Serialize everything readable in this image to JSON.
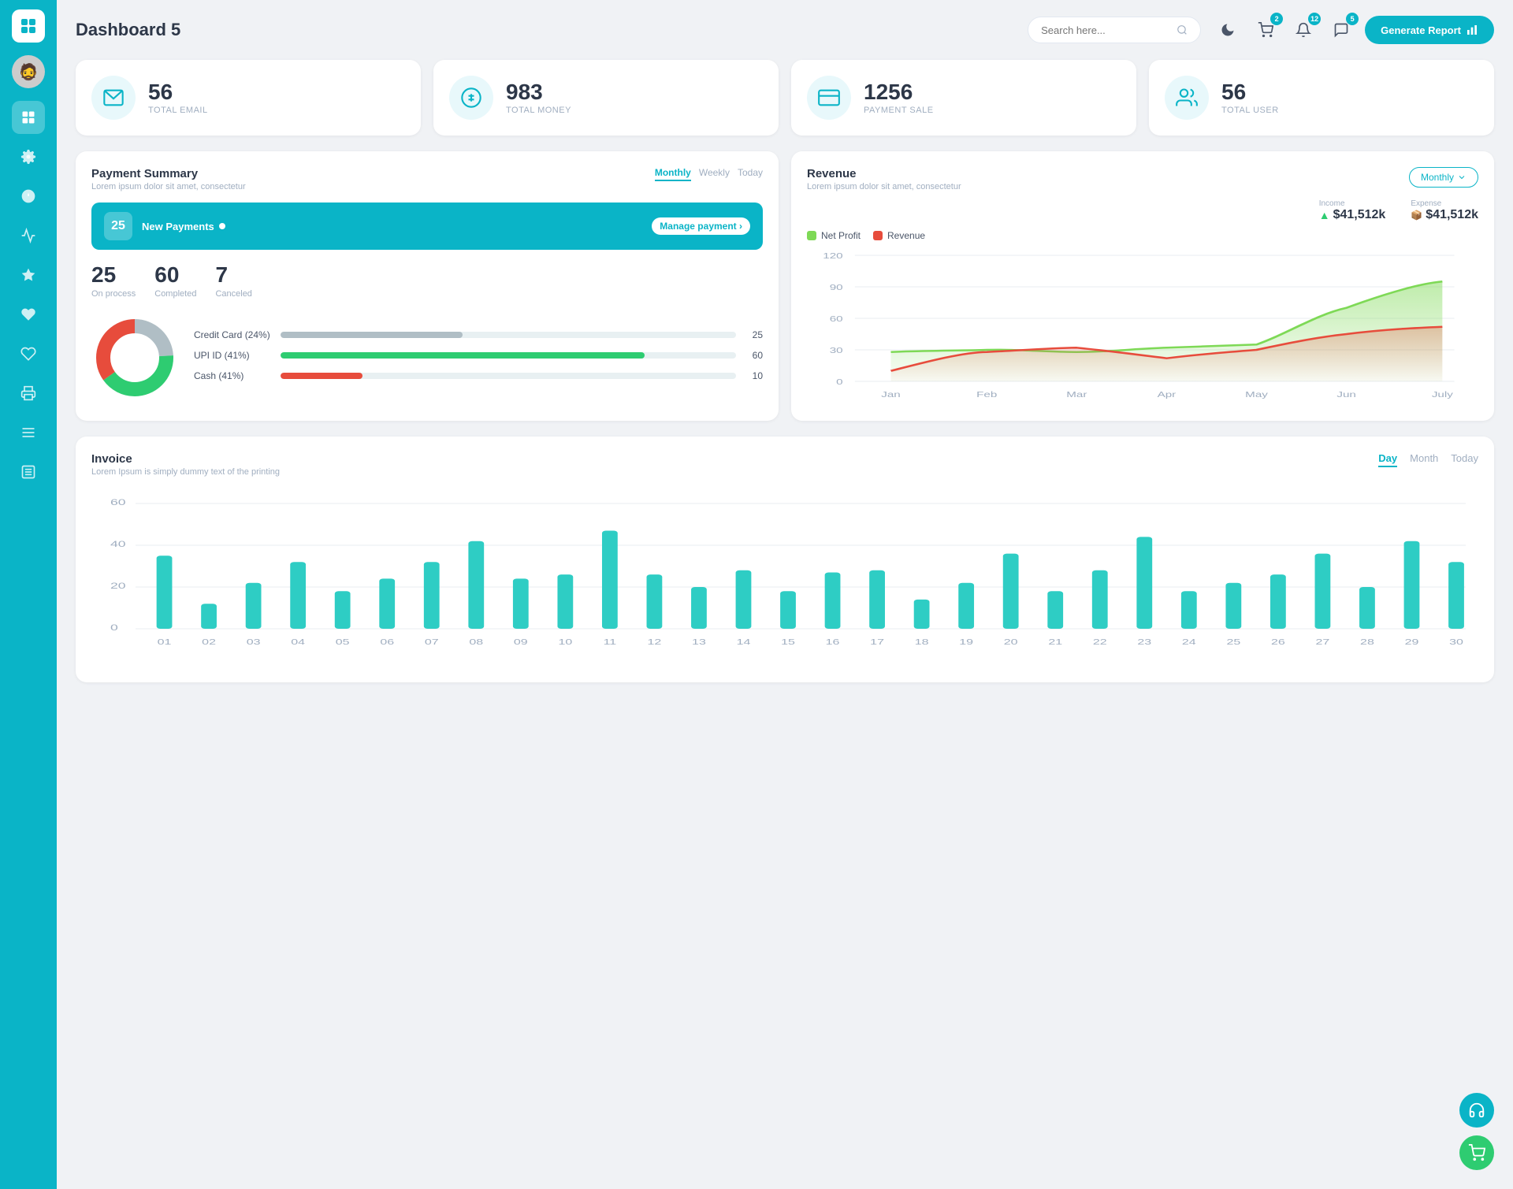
{
  "app": {
    "title": "Dashboard 5"
  },
  "header": {
    "search_placeholder": "Search here...",
    "generate_btn": "Generate Report",
    "badges": {
      "cart": "2",
      "bell": "12",
      "chat": "5"
    }
  },
  "stats": [
    {
      "id": "email",
      "num": "56",
      "label": "TOTAL EMAIL",
      "icon": "📋"
    },
    {
      "id": "money",
      "num": "983",
      "label": "TOTAL MONEY",
      "icon": "💲"
    },
    {
      "id": "payment",
      "num": "1256",
      "label": "PAYMENT SALE",
      "icon": "💳"
    },
    {
      "id": "user",
      "num": "56",
      "label": "TOTAL USER",
      "icon": "👥"
    }
  ],
  "payment_summary": {
    "title": "Payment Summary",
    "subtitle": "Lorem ipsum dolor sit amet, consectetur",
    "tabs": [
      "Monthly",
      "Weekly",
      "Today"
    ],
    "active_tab": "Monthly",
    "new_payments_count": "25",
    "new_payments_label": "New Payments",
    "manage_link": "Manage payment",
    "stats": [
      {
        "num": "25",
        "label": "On process"
      },
      {
        "num": "60",
        "label": "Completed"
      },
      {
        "num": "7",
        "label": "Canceled"
      }
    ],
    "bars": [
      {
        "label": "Credit Card (24%)",
        "pct": 40,
        "color": "#b0bec5",
        "val": "25"
      },
      {
        "label": "UPI ID (41%)",
        "pct": 80,
        "color": "#2ecc71",
        "val": "60"
      },
      {
        "label": "Cash (41%)",
        "pct": 18,
        "color": "#e74c3c",
        "val": "10"
      }
    ],
    "donut": {
      "segments": [
        {
          "pct": 24,
          "color": "#b0bec5"
        },
        {
          "pct": 41,
          "color": "#2ecc71"
        },
        {
          "pct": 35,
          "color": "#e74c3c"
        }
      ]
    }
  },
  "revenue": {
    "title": "Revenue",
    "subtitle": "Lorem ipsum dolor sit amet, consectetur",
    "active_tab": "Monthly",
    "income_label": "Income",
    "income_val": "$41,512k",
    "expense_label": "Expense",
    "expense_val": "$41,512k",
    "legend": [
      {
        "label": "Net Profit",
        "color": "#7ed956"
      },
      {
        "label": "Revenue",
        "color": "#e74c3c"
      }
    ],
    "chart": {
      "labels": [
        "Jan",
        "Feb",
        "Mar",
        "Apr",
        "May",
        "Jun",
        "July"
      ],
      "net_profit": [
        28,
        30,
        28,
        32,
        35,
        70,
        95
      ],
      "revenue": [
        10,
        28,
        32,
        22,
        30,
        45,
        52
      ]
    }
  },
  "invoice": {
    "title": "Invoice",
    "subtitle": "Lorem Ipsum is simply dummy text of the printing",
    "tabs": [
      "Day",
      "Month",
      "Today"
    ],
    "active_tab": "Day",
    "y_labels": [
      "60",
      "40",
      "20",
      "0"
    ],
    "x_labels": [
      "01",
      "02",
      "03",
      "04",
      "05",
      "06",
      "07",
      "08",
      "09",
      "10",
      "11",
      "12",
      "13",
      "14",
      "15",
      "16",
      "17",
      "18",
      "19",
      "20",
      "21",
      "22",
      "23",
      "24",
      "25",
      "26",
      "27",
      "28",
      "29",
      "30"
    ],
    "bars": [
      35,
      12,
      22,
      32,
      18,
      24,
      32,
      42,
      24,
      26,
      47,
      26,
      20,
      28,
      18,
      27,
      28,
      14,
      22,
      36,
      18,
      28,
      44,
      18,
      22,
      26,
      36,
      20,
      42,
      32
    ]
  },
  "fab": {
    "support_icon": "🎧",
    "cart_icon": "🛒"
  }
}
